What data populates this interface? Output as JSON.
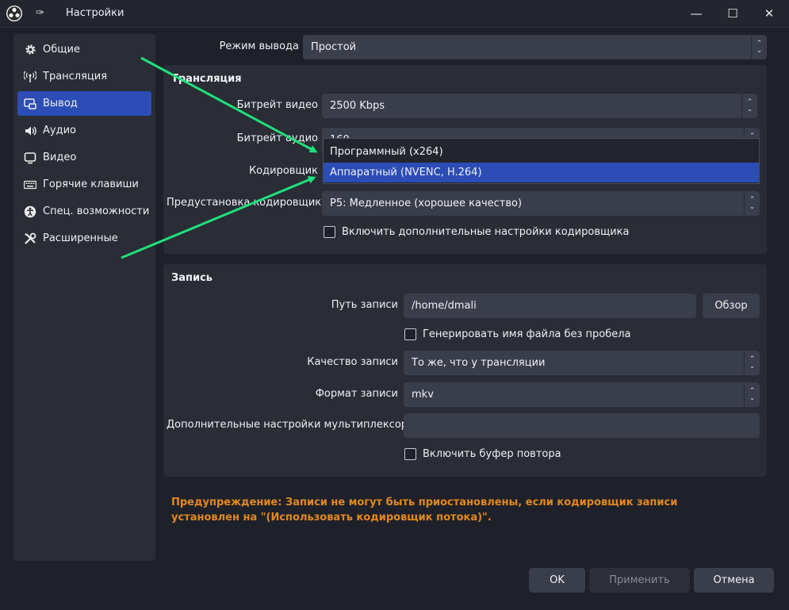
{
  "window": {
    "title": "Настройки",
    "logo_icon": "obs-logo-icon",
    "pin_icon": "pin-icon",
    "minimize": "—",
    "maximize": "☐",
    "close": "✕"
  },
  "sidebar": {
    "items": [
      {
        "label": "Общие",
        "icon": "gear-icon",
        "active": false
      },
      {
        "label": "Трансляция",
        "icon": "broadcast-icon",
        "active": false
      },
      {
        "label": "Вывод",
        "icon": "output-icon",
        "active": true
      },
      {
        "label": "Аудио",
        "icon": "speaker-icon",
        "active": false
      },
      {
        "label": "Видео",
        "icon": "monitor-icon",
        "active": false
      },
      {
        "label": "Горячие клавиши",
        "icon": "keyboard-icon",
        "active": false
      },
      {
        "label": "Спец. возможности",
        "icon": "accessibility-icon",
        "active": false
      },
      {
        "label": "Расширенные",
        "icon": "tools-icon",
        "active": false
      }
    ]
  },
  "output_mode": {
    "label": "Режим вывода",
    "value": "Простой"
  },
  "streaming": {
    "title": "Трансляция",
    "video_bitrate_label": "Битрейт видео",
    "video_bitrate_value": "2500 Kbps",
    "audio_bitrate_label": "Битрейт аудио",
    "audio_bitrate_value": "160",
    "encoder_label": "Кодировщик",
    "encoder_options": [
      "Программный (x264)",
      "Аппаратный (NVENC, H.264)"
    ],
    "encoder_selected_index": 1,
    "preset_label": "Предустановка кодировщика",
    "preset_value": "P5: Медленное (хорошее качество)",
    "advanced_checkbox_label": "Включить дополнительные настройки кодировщика"
  },
  "recording": {
    "title": "Запись",
    "path_label": "Путь записи",
    "path_value": "/home/dmali",
    "browse_label": "Обзор",
    "no_space_label": "Генерировать имя файла без пробела",
    "quality_label": "Качество записи",
    "quality_value": "То же, что у трансляции",
    "format_label": "Формат записи",
    "format_value": "mkv",
    "muxer_label": "Дополнительные настройки мультиплексора",
    "muxer_value": "",
    "replay_buffer_label": "Включить буфер повтора"
  },
  "warning": "Предупреждение: Записи не могут быть приостановлены, если кодировщик записи установлен на \"(Использовать кодировщик потока)\".",
  "buttons": {
    "ok": "OK",
    "apply": "Применить",
    "cancel": "Отмена"
  },
  "colors": {
    "accent": "#2b4db5",
    "warning": "#e2891f",
    "annotation_arrow": "#1fe07a"
  }
}
